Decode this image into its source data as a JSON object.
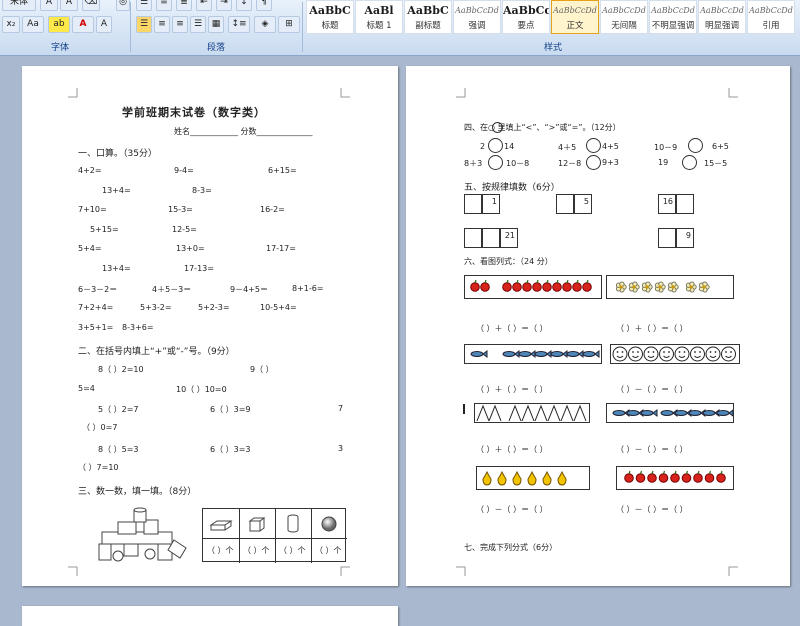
{
  "ribbon": {
    "font_name": "宋体",
    "font_group": "字体",
    "paragraph_group": "段落",
    "styles_group": "样式",
    "styles": [
      {
        "sample": "AaBbC",
        "name": "标题",
        "fancy": false
      },
      {
        "sample": "AaBl",
        "name": "标题 1",
        "fancy": false
      },
      {
        "sample": "AaBbC",
        "name": "副标题",
        "fancy": false
      },
      {
        "sample": "AaBbCcDd",
        "name": "强调",
        "fancy": true
      },
      {
        "sample": "AaBbCcD",
        "name": "要点",
        "fancy": false
      },
      {
        "sample": "AaBbCcDd",
        "name": "正文",
        "fancy": true
      },
      {
        "sample": "AaBbCcDd",
        "name": "无间隔",
        "fancy": true
      },
      {
        "sample": "AaBbCcDd",
        "name": "不明显强调",
        "fancy": true
      },
      {
        "sample": "AaBbCcDd",
        "name": "明显强调",
        "fancy": true
      },
      {
        "sample": "AaBbCcDd",
        "name": "引用",
        "fancy": true
      }
    ],
    "active_style": "正文"
  },
  "page1": {
    "title": "学前班期末试卷（数字类）",
    "name_line": "姓名____________ 分数______________",
    "s1_title": "一、口算。（35分）",
    "s1_lines": [
      [
        "4+2=",
        "9-4=",
        "6+15="
      ],
      [
        "13+4=",
        "8-3="
      ],
      [
        "7+10=",
        "15-3=",
        "16-2="
      ],
      [
        "5+15=",
        "12-5="
      ],
      [
        "5+4=",
        "13+0=",
        "17-17="
      ],
      [
        "13+4=",
        "17-13="
      ],
      [
        "6－3－2＝",
        "4＋5－3＝",
        "9－4+5＝",
        "8+1-6="
      ],
      [
        "7+2+4=",
        "5+3-2=",
        "5+2-3=",
        "10-5+4="
      ],
      [
        "3+5+1=",
        "8-3+6="
      ]
    ],
    "s2_title": "二、在括号内填上“+”或“-”号。（9分）",
    "s2_lines": [
      "8（        ）2=10",
      "9（        ）",
      "5=4",
      "10（        ）10=0",
      "5（    ）2=7",
      "6（    ）3=9",
      "7",
      "（      ）0=7",
      "8（    ）5=3",
      "6（    ）3=3",
      "3",
      "（         ）7=10"
    ],
    "s3_title": "三、数一数，填一填。（8分）",
    "s3_answer": "（  ）个"
  },
  "page2": {
    "s4_title": "四、在○ 里填上“<”、“>”或“=”。（12分）",
    "s4_items": [
      "2",
      "14",
      "4＋5",
      "4+5",
      "10－9",
      "6+5",
      "8＋3",
      "10－8",
      "12－8",
      "9+3",
      "19",
      "15－5"
    ],
    "s5_title": "五、按规律填数（6分）",
    "s5_values": [
      "1",
      "5",
      "16",
      "21",
      "9"
    ],
    "s6_title": "六、看图列式：（24 分）",
    "s6_formula_a": "（   ）＋（   ）＝（   ）",
    "s6_formula_b": "（   ）－（   ）＝（   ）",
    "s7_title": "七、完成下列分式（6分）"
  },
  "colors": {
    "workspace": "#a9b8cf",
    "ribbon_text": "#15428b",
    "apple": "#d8231c",
    "fish": "#4d86b8"
  }
}
